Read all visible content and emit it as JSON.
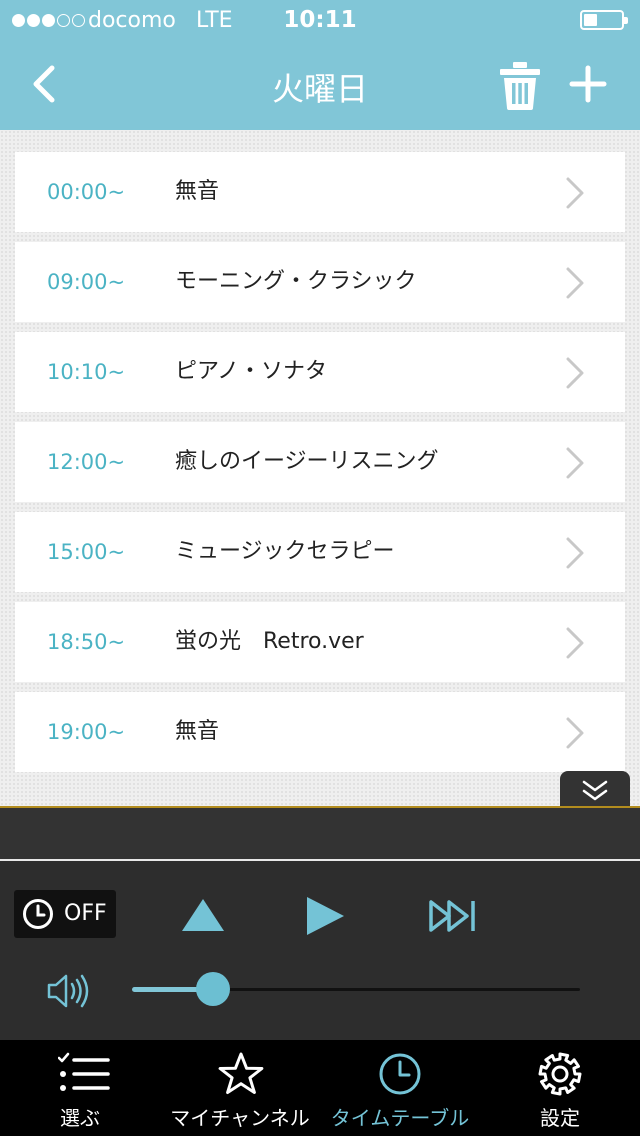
{
  "status_bar": {
    "carrier": "docomo",
    "network": "LTE",
    "time": "10:11",
    "signal_bars_filled": 3,
    "signal_bars_total": 5,
    "battery_level": 0.35
  },
  "nav": {
    "title": "火曜日",
    "back_icon": "chevron-left-icon",
    "delete_icon": "trash-icon",
    "add_icon": "plus-icon"
  },
  "schedule": [
    {
      "time": "00:00~",
      "title": "無音"
    },
    {
      "time": "09:00~",
      "title": "モーニング・クラシック"
    },
    {
      "time": "10:10~",
      "title": "ピアノ・ソナタ"
    },
    {
      "time": "12:00~",
      "title": "癒しのイージーリスニング"
    },
    {
      "time": "15:00~",
      "title": "ミュージックセラピー"
    },
    {
      "time": "18:50~",
      "title": "蛍の光　Retro.ver"
    },
    {
      "time": "19:00~",
      "title": "無音"
    }
  ],
  "player": {
    "timer_label": "OFF",
    "volume_level": 0.18
  },
  "tabs": [
    {
      "label": "選ぶ",
      "icon": "list-check-icon",
      "active": false
    },
    {
      "label": "マイチャンネル",
      "icon": "star-icon",
      "active": false
    },
    {
      "label": "タイムテーブル",
      "icon": "clock-icon",
      "active": true
    },
    {
      "label": "設定",
      "icon": "gear-icon",
      "active": false
    }
  ],
  "colors": {
    "accent": "#81c6d7",
    "time_text": "#4bb3c4",
    "player_bg": "#2d2d2d",
    "tab_bar_bg": "#000000"
  }
}
